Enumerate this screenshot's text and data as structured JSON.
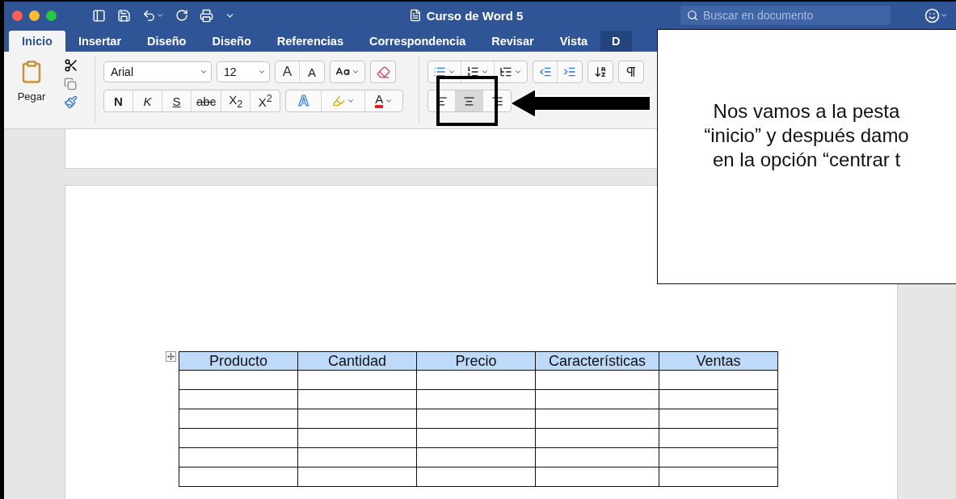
{
  "window": {
    "title": "Curso de Word 5",
    "search": {
      "placeholder": "Buscar en documento"
    }
  },
  "tabs": [
    {
      "label": "Inicio",
      "selected": true,
      "kind": "tab"
    },
    {
      "label": "Insertar",
      "selected": false,
      "kind": "tab"
    },
    {
      "label": "Diseño",
      "selected": false,
      "kind": "tab"
    },
    {
      "label": "Diseño",
      "selected": false,
      "kind": "tab"
    },
    {
      "label": "Referencias",
      "selected": false,
      "kind": "tab"
    },
    {
      "label": "Correspondencia",
      "selected": false,
      "kind": "tab"
    },
    {
      "label": "Revisar",
      "selected": false,
      "kind": "tab"
    },
    {
      "label": "Vista",
      "selected": false,
      "kind": "tab"
    },
    {
      "label": "D",
      "selected": false,
      "kind": "contextual"
    }
  ],
  "ribbon": {
    "paste": {
      "label": "Pegar"
    },
    "font": {
      "name": "Arial",
      "size": "12",
      "grow": "A",
      "shrink": "A"
    },
    "format_buttons": [
      {
        "label": "N",
        "kind": "bold"
      },
      {
        "label": "K",
        "kind": "italic"
      },
      {
        "label": "S",
        "kind": "underline"
      },
      {
        "label": "abc",
        "kind": "strike"
      },
      {
        "label": "X$_{2}$",
        "kind": "plain"
      },
      {
        "label": "X$^{2}$",
        "kind": "plain"
      }
    ],
    "text_effects": "A",
    "font_color": "A",
    "alignment": [
      {
        "kind": "left",
        "selected": false
      },
      {
        "kind": "center",
        "selected": true
      },
      {
        "kind": "right",
        "selected": false
      }
    ]
  },
  "table": {
    "columns": [
      "Producto",
      "Cantidad",
      "Precio",
      "Características",
      "Ventas"
    ],
    "rows": [
      {
        "kind": "empty"
      },
      {
        "kind": "empty"
      },
      {
        "kind": "empty"
      },
      {
        "kind": "empty"
      },
      {
        "kind": "empty"
      },
      {
        "kind": "empty"
      }
    ]
  },
  "callout": {
    "lines": [
      "Nos vamos a la pesta",
      "“inicio” y después damo",
      "en la opción “centrar t"
    ]
  }
}
